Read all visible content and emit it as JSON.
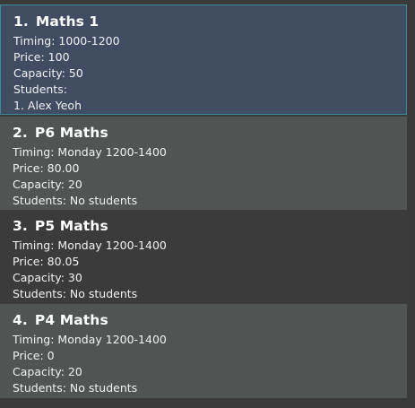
{
  "classes": [
    {
      "index": "1.",
      "name": "Maths 1",
      "timing": "Timing: 1000-1200",
      "price": "Price: 100",
      "capacity": "Capacity: 50",
      "students": "Students:",
      "student_list": [
        "1.  Alex Yeoh"
      ]
    },
    {
      "index": "2.",
      "name": "P6 Maths",
      "timing": "Timing: Monday 1200-1400",
      "price": "Price: 80.00",
      "capacity": "Capacity: 20",
      "students": "Students: No students"
    },
    {
      "index": "3.",
      "name": "P5 Maths",
      "timing": "Timing: Monday 1200-1400",
      "price": "Price: 80.05",
      "capacity": "Capacity: 30",
      "students": "Students: No students"
    },
    {
      "index": "4.",
      "name": "P4 Maths",
      "timing": "Timing: Monday 1200-1400",
      "price": "Price: 0",
      "capacity": "Capacity: 20",
      "students": "Students: No students"
    }
  ],
  "colors": {
    "selected_bg": "#3f4c61",
    "selected_border": "#3c8a9a",
    "light_bg": "#505554",
    "dark_bg": "#3b3b3b",
    "text": "#ffffff"
  }
}
